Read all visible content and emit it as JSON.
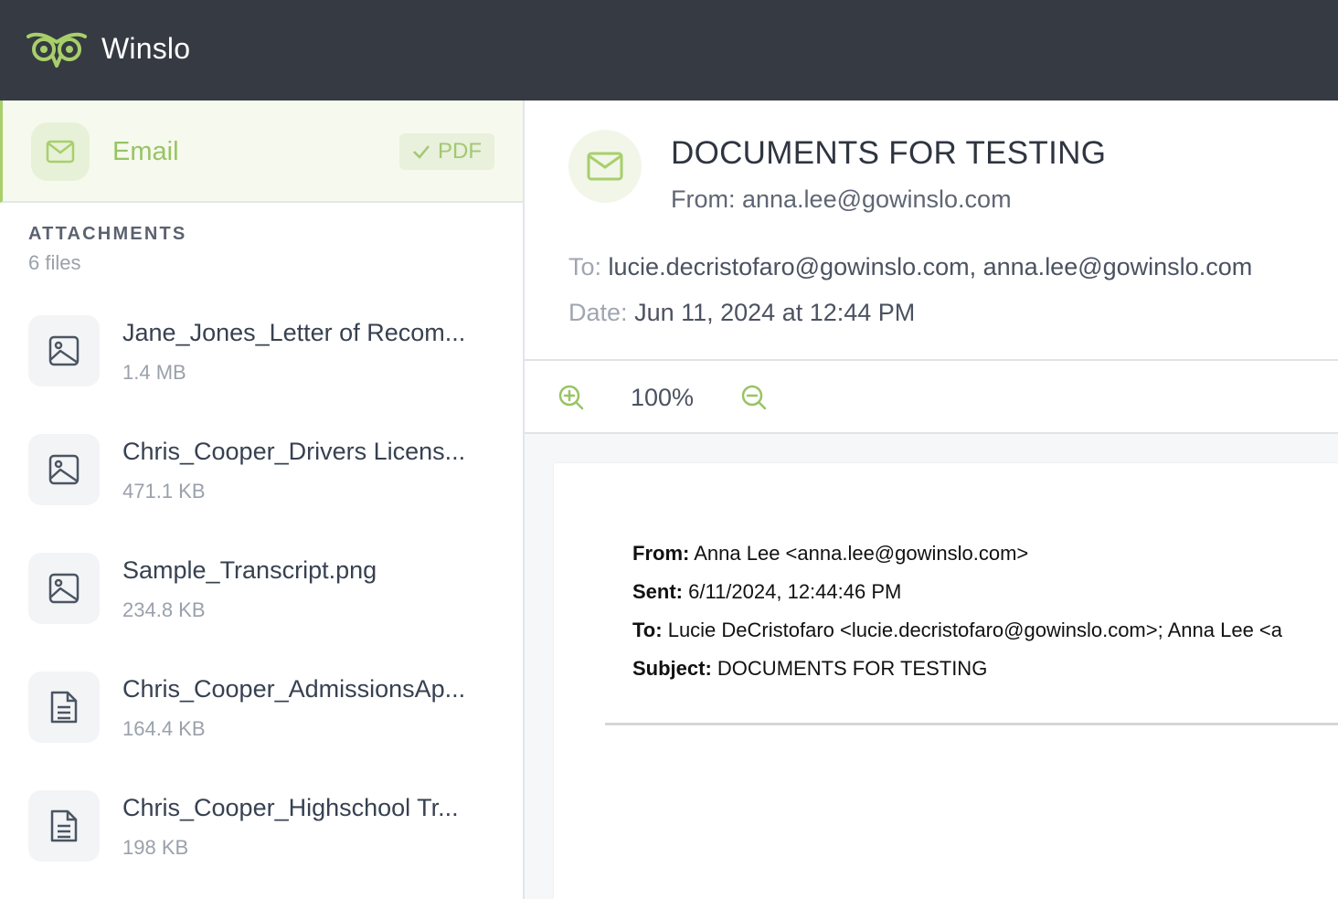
{
  "app": {
    "name": "Winslo"
  },
  "sidebar": {
    "email_item": {
      "label": "Email",
      "badge": "PDF"
    },
    "attachments_heading": "ATTACHMENTS",
    "attachments_count": "6 files",
    "files": [
      {
        "name": "Jane_Jones_Letter of Recom...",
        "size": "1.4 MB",
        "icon": "image-icon"
      },
      {
        "name": "Chris_Cooper_Drivers Licens...",
        "size": "471.1 KB",
        "icon": "image-icon"
      },
      {
        "name": "Sample_Transcript.png",
        "size": "234.8 KB",
        "icon": "image-icon"
      },
      {
        "name": "Chris_Cooper_AdmissionsAp...",
        "size": "164.4 KB",
        "icon": "document-icon"
      },
      {
        "name": "Chris_Cooper_Highschool Tr...",
        "size": "198 KB",
        "icon": "document-icon"
      }
    ]
  },
  "email": {
    "subject": "DOCUMENTS FOR TESTING",
    "from": "From: anna.lee@gowinslo.com",
    "to_label": "To:",
    "to_value": "lucie.decristofaro@gowinslo.com, anna.lee@gowinslo.com",
    "date_label": "Date:",
    "date_value": "Jun 11, 2024 at 12:44 PM"
  },
  "toolbar": {
    "zoom": "100%"
  },
  "preview": {
    "from_label": "From:",
    "from_value": "Anna Lee <anna.lee@gowinslo.com>",
    "sent_label": "Sent:",
    "sent_value": "6/11/2024, 12:44:46 PM",
    "to_label": "To:",
    "to_value": "Lucie DeCristofaro <lucie.decristofaro@gowinslo.com>; Anna Lee <a",
    "subject_label": "Subject:",
    "subject_value": "DOCUMENTS FOR TESTING"
  },
  "colors": {
    "accent": "#98c463",
    "topbar": "#363a42"
  }
}
